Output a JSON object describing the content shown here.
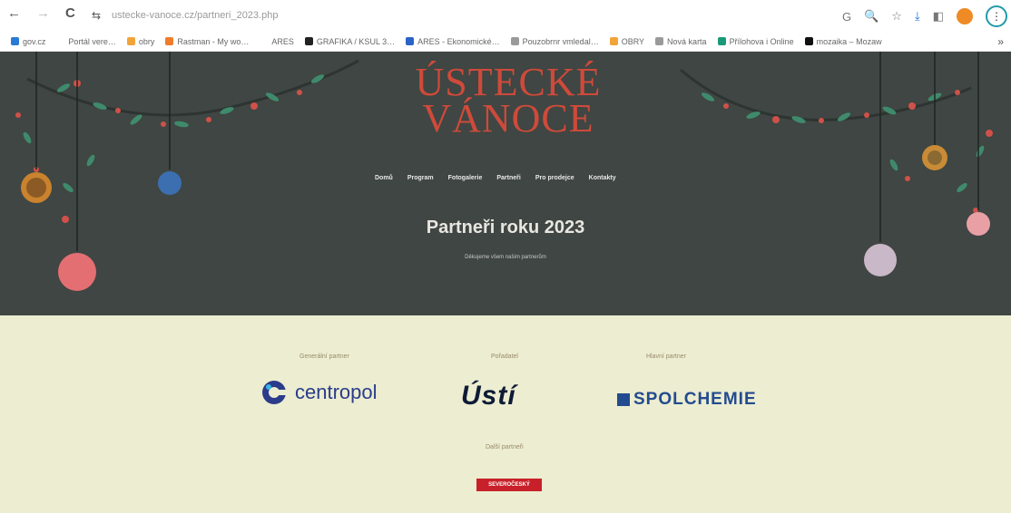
{
  "browser": {
    "url": "ustecke-vanoce.cz/partneri_2023.php",
    "nav": {
      "back": "←",
      "forward": "→",
      "reload": "C",
      "site_info": "⇆"
    },
    "toolbar_icons": {
      "translate": "G",
      "zoom": "🔍",
      "star": "☆",
      "download": "⤓",
      "sidepanel": "◧",
      "menu": "⋮"
    },
    "bookmarks": [
      {
        "label": "gov.cz",
        "color": "#2a7ad6"
      },
      {
        "label": "Portál vere…",
        "color": "#ffffff"
      },
      {
        "label": "obry",
        "color": "#f2a43a"
      },
      {
        "label": "Rastman - My wo…",
        "color": "#f07b2a"
      },
      {
        "label": "ARES",
        "color": "#ffffff"
      },
      {
        "label": "GRAFIKA / KSUL 3…",
        "color": "#222222"
      },
      {
        "label": "ARES - Ekonomické…",
        "color": "#2a63c7"
      },
      {
        "label": "Pouzobrnr vmledal…",
        "color": "#9a9a9a"
      },
      {
        "label": "OBRY",
        "color": "#f2a43a"
      },
      {
        "label": "Nová karta",
        "color": "#9a9a9a"
      },
      {
        "label": "Přílohova i Online",
        "color": "#1a9a7a"
      },
      {
        "label": "mozaika – Mozaw",
        "color": "#111111"
      }
    ],
    "bookmarks_more": "»"
  },
  "site": {
    "logo_line1": "ÚSTECKÉ",
    "logo_line2": "VÁNOCE",
    "nav": [
      "Domů",
      "Program",
      "Fotogalerie",
      "Partneři",
      "Pro prodejce",
      "Kontakty"
    ],
    "title": "Partneři roku 2023",
    "subtitle": "Děkujeme všem našim partnerům"
  },
  "partners": {
    "general_label": "Generální partner",
    "organizer_label": "Pořadatel",
    "main_label": "Hlavní partner",
    "other_label": "Další partneři",
    "centropol": "centropol",
    "usti": "Ústí",
    "spolchemie": "SPOLCHEMIE",
    "other_logo": "SEVEROČESKÝ"
  }
}
